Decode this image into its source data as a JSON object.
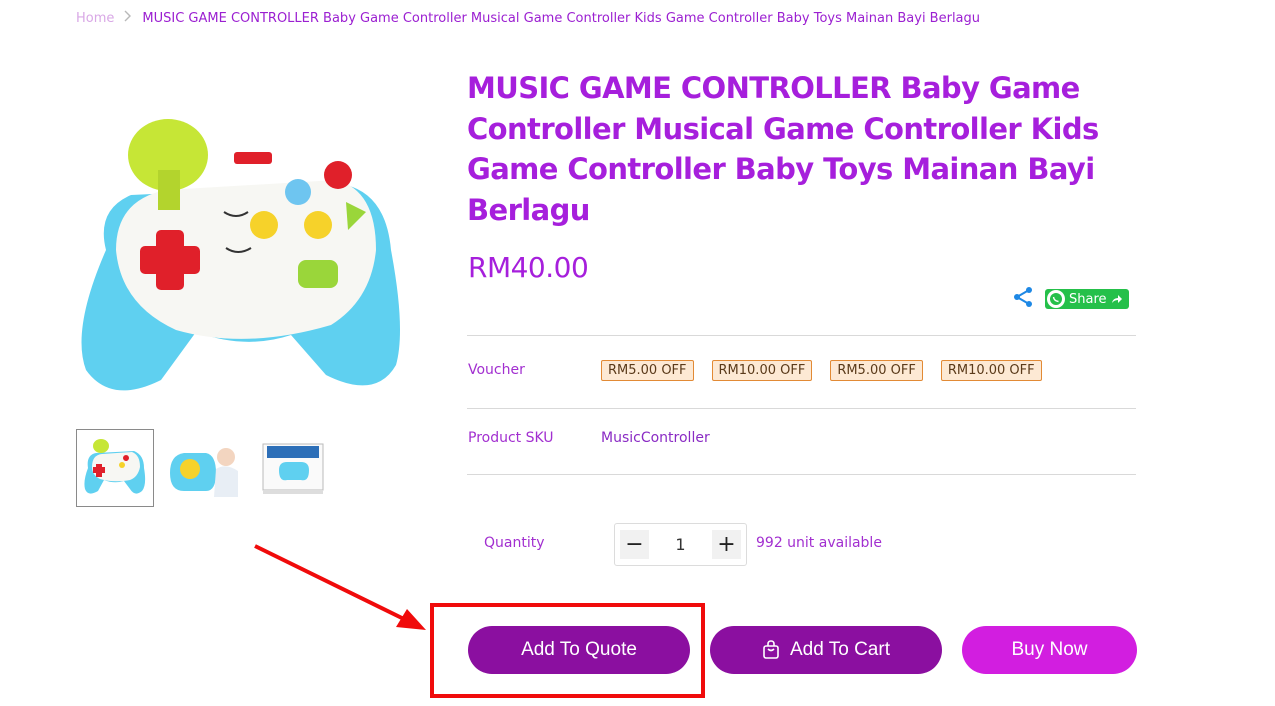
{
  "breadcrumb": {
    "home": "Home",
    "separator_icon": "chevron-right-icon",
    "current": "MUSIC GAME CONTROLLER Baby Game Controller Musical Game Controller Kids Game Controller Baby Toys Mainan Bayi Berlagu"
  },
  "product": {
    "title": "MUSIC GAME CONTROLLER Baby Game Controller Musical Game Controller Kids Game Controller Baby Toys Mainan Bayi Berlagu",
    "price": "RM40.00",
    "share": {
      "share_icon": "share-icon",
      "whatsapp_label": "Share",
      "whatsapp_icon": "whatsapp-icon"
    },
    "voucher": {
      "label": "Voucher",
      "items": [
        "RM5.00 OFF",
        "RM10.00 OFF",
        "RM5.00 OFF",
        "RM10.00 OFF"
      ]
    },
    "sku": {
      "label": "Product SKU",
      "value": "MusicController"
    },
    "quantity": {
      "label": "Quantity",
      "value": "1",
      "minus": "−",
      "plus": "+",
      "available": "992 unit available"
    }
  },
  "actions": {
    "add_to_quote": "Add To Quote",
    "add_to_cart": "Add To Cart",
    "buy_now": "Buy Now",
    "cart_icon": "shopping-bag-icon"
  },
  "colors": {
    "title": "#a61fdc",
    "primary_button": "#8b0fa0",
    "buy_button": "#d21ee0",
    "highlight": "#f00b0b",
    "voucher_bg": "#fde9d4",
    "voucher_border": "#e28a35"
  }
}
